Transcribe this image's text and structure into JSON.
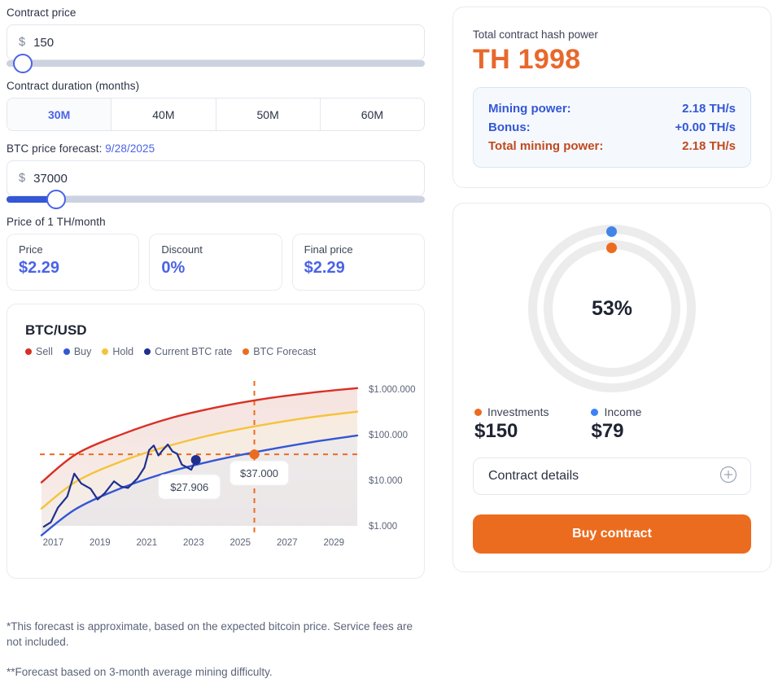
{
  "contract_price": {
    "label": "Contract price",
    "currency": "$",
    "value": "150",
    "slider_percent": 0
  },
  "contract_duration": {
    "label": "Contract duration (months)",
    "options": [
      "30M",
      "40M",
      "50M",
      "60M"
    ],
    "selected": "30M"
  },
  "btc_forecast": {
    "label_prefix": "BTC price forecast: ",
    "date": "9/28/2025",
    "currency": "$",
    "value": "37000",
    "slider_percent": 10
  },
  "price_section": {
    "heading": "Price of 1 TH/month",
    "cards": [
      {
        "label": "Price",
        "value": "$2.29"
      },
      {
        "label": "Discount",
        "value": "0%"
      },
      {
        "label": "Final price",
        "value": "$2.29"
      }
    ]
  },
  "chart_data": {
    "type": "line",
    "title": "BTC/USD",
    "xlabel": "",
    "ylabel": "",
    "log_scale": true,
    "grid": false,
    "legend_position": "top-left",
    "x_ticks": [
      "2017",
      "2019",
      "2021",
      "2023",
      "2025",
      "2027",
      "2029"
    ],
    "y_ticks": [
      "$1.000",
      "$10.000",
      "$100.000",
      "$1.000.000"
    ],
    "ylim": [
      1000,
      1000000
    ],
    "xlim": [
      2016.5,
      2030
    ],
    "legend": [
      {
        "name": "Sell",
        "color": "#d93025"
      },
      {
        "name": "Buy",
        "color": "#3457d5"
      },
      {
        "name": "Hold",
        "color": "#f5c33b"
      },
      {
        "name": "Current BTC rate",
        "color": "#1f2f8f"
      },
      {
        "name": "BTC Forecast",
        "color": "#ec6c1f"
      }
    ],
    "series": [
      {
        "name": "Sell",
        "color": "#d93025",
        "x": [
          2016.5,
          2018,
          2020,
          2022,
          2024,
          2026,
          2028,
          2030
        ],
        "y": [
          9000,
          38000,
          105000,
          230000,
          400000,
          610000,
          830000,
          1050000
        ]
      },
      {
        "name": "Hold",
        "color": "#f5c33b",
        "x": [
          2016.5,
          2018,
          2020,
          2022,
          2024,
          2026,
          2028,
          2030
        ],
        "y": [
          2400,
          9500,
          27000,
          58000,
          105000,
          165000,
          240000,
          320000
        ]
      },
      {
        "name": "Buy",
        "color": "#3457d5",
        "x": [
          2016.5,
          2018,
          2020,
          2022,
          2024,
          2026,
          2028,
          2030
        ],
        "y": [
          620,
          2400,
          7000,
          15500,
          28000,
          45000,
          68000,
          96000
        ]
      },
      {
        "name": "Current BTC rate",
        "color": "#1f2f8f",
        "x": [
          2016.6,
          2016.9,
          2017.2,
          2017.6,
          2017.9,
          2018.2,
          2018.6,
          2018.9,
          2019.2,
          2019.6,
          2019.9,
          2020.2,
          2020.6,
          2020.9,
          2021.1,
          2021.3,
          2021.5,
          2021.7,
          2021.9,
          2022.1,
          2022.3,
          2022.5,
          2022.7,
          2022.9,
          2023.1
        ],
        "y": [
          960,
          1200,
          2500,
          4400,
          14000,
          8500,
          6500,
          3800,
          5200,
          9500,
          7300,
          6800,
          11000,
          19000,
          46000,
          58000,
          35000,
          47000,
          61000,
          43000,
          38000,
          22000,
          19500,
          17000,
          27906
        ]
      }
    ],
    "annotations": [
      {
        "name": "current-rate-marker",
        "label": "$27.906",
        "x": 2023.1,
        "y": 27906,
        "color": "#1f2f8f"
      },
      {
        "name": "forecast-marker",
        "label": "$37.000",
        "x": 2025.6,
        "y": 37000,
        "color": "#ec6c1f"
      }
    ],
    "crosshair": {
      "x": 2025.6,
      "y": 37000,
      "color": "#ec6c1f",
      "style": "dashed"
    }
  },
  "footnotes": [
    "*This forecast is approximate, based on the expected bitcoin price. Service fees are not included.",
    "**Forecast based on 3-month average mining difficulty."
  ],
  "hash_card": {
    "subtitle": "Total contract hash power",
    "headline": "TH 1998",
    "rows": [
      {
        "key": "Mining power:",
        "value": "2.18 TH/s",
        "total": false
      },
      {
        "key": "Bonus:",
        "value": "+0.00 TH/s",
        "total": false
      },
      {
        "key": "Total mining power:",
        "value": "2.18 TH/s",
        "total": true
      }
    ]
  },
  "summary_card": {
    "donut": {
      "percent_label": "53%",
      "percent": 53,
      "outer_dot_color": "#4285e8",
      "inner_dot_color": "#ec6c1f",
      "ring_color": "#ececec"
    },
    "stats": [
      {
        "label": "Investments",
        "value": "$150",
        "color": "#ec6c1f"
      },
      {
        "label": "Income",
        "value": "$79",
        "color": "#3b82f6"
      }
    ],
    "details_label": "Contract details",
    "details_icon": "plus-circle-icon",
    "buy_label": "Buy contract"
  },
  "colors": {
    "accent_orange": "#ec6c1f",
    "accent_blue": "#4a63e7",
    "headline_orange": "#e8682c",
    "total_red": "#c1491f"
  }
}
